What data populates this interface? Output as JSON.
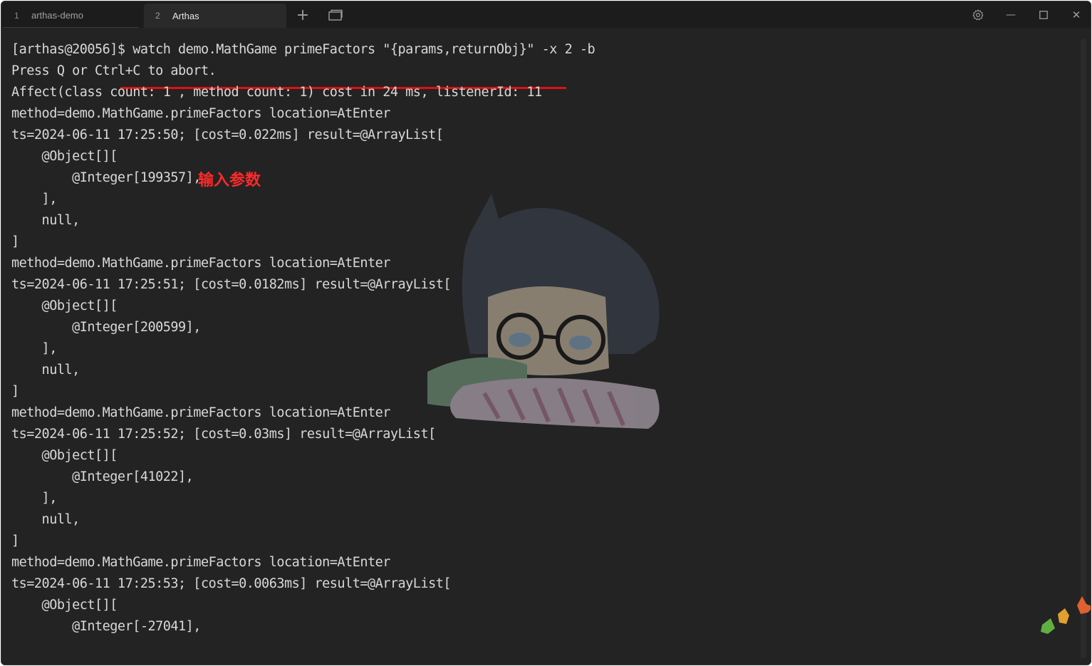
{
  "tabs": [
    {
      "num": "1",
      "label": "arthas-demo"
    },
    {
      "num": "2",
      "label": "Arthas"
    }
  ],
  "toolbar": {
    "new_tab": "+",
    "settings_icon": "gear-icon",
    "minimize": "—",
    "maximize": "☐",
    "close": "✕"
  },
  "terminal": {
    "prompt": "[arthas@20056]$ ",
    "command": "watch demo.MathGame primeFactors \"{params,returnObj}\" -x 2 -b",
    "lines": [
      "Press Q or Ctrl+C to abort.",
      "Affect(class count: 1 , method count: 1) cost in 24 ms, listenerId: 11",
      "method=demo.MathGame.primeFactors location=AtEnter",
      "ts=2024-06-11 17:25:50; [cost=0.022ms] result=@ArrayList[",
      "    @Object[][",
      "        @Integer[199357],",
      "    ],",
      "    null,",
      "]",
      "method=demo.MathGame.primeFactors location=AtEnter",
      "ts=2024-06-11 17:25:51; [cost=0.0182ms] result=@ArrayList[",
      "    @Object[][",
      "        @Integer[200599],",
      "    ],",
      "    null,",
      "]",
      "method=demo.MathGame.primeFactors location=AtEnter",
      "ts=2024-06-11 17:25:52; [cost=0.03ms] result=@ArrayList[",
      "    @Object[][",
      "        @Integer[41022],",
      "    ],",
      "    null,",
      "]",
      "method=demo.MathGame.primeFactors location=AtEnter",
      "ts=2024-06-11 17:25:53; [cost=0.0063ms] result=@ArrayList[",
      "    @Object[][",
      "        @Integer[-27041],"
    ],
    "annotation": "输入参数"
  },
  "colors": {
    "background": "#232323",
    "text": "#d8d8d8",
    "annotation": "#ff2a2a",
    "underline": "#e01010"
  }
}
